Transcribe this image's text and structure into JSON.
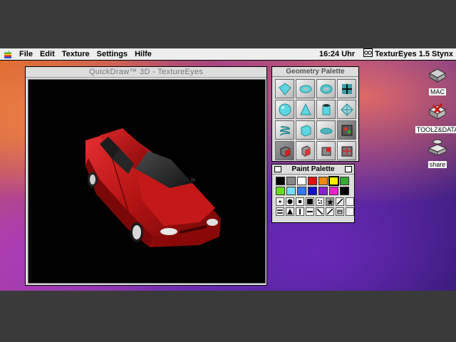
{
  "menubar": {
    "items": [
      "File",
      "Edit",
      "Texture",
      "Settings",
      "Hilfe"
    ],
    "clock": "16:24 Uhr",
    "app_name": "TexturEyes 1.5 Stynx"
  },
  "main_window": {
    "title": "QuickDraw™ 3D - TextureEyes"
  },
  "geometry_palette": {
    "title": "Geometry Palette"
  },
  "paint_palette": {
    "title": "Paint Palette",
    "colors": [
      "#000000",
      "#888888",
      "#ffffff",
      "#dd1111",
      "#ee8811",
      "#ffee00",
      "#33aa33",
      "#66dd22",
      "#77ddff",
      "#3377ff",
      "#1111cc",
      "#8822cc",
      "#ee22cc",
      "#000000"
    ],
    "selected_color": "#ffee00"
  },
  "desktop_icons": [
    {
      "label": "MAC"
    },
    {
      "label": "TOOLZ&DATA"
    },
    {
      "label": "share"
    }
  ]
}
